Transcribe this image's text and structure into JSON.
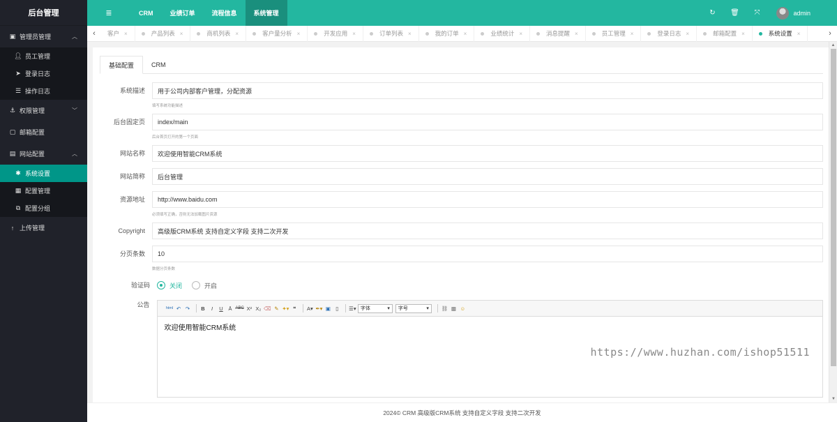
{
  "app": {
    "logo": "后台管理"
  },
  "sidebar": {
    "groups": [
      {
        "label": "管理员管理",
        "icon": "id-card-icon",
        "caret": "⌃"
      },
      {
        "label": "权限管理",
        "icon": "anchor-icon",
        "caret": "⌄"
      },
      {
        "label": "邮箱配置",
        "icon": "mail-icon"
      },
      {
        "label": "网站配置",
        "icon": "settings-icon",
        "caret": "⌃"
      },
      {
        "label": "上传管理",
        "icon": "upload-icon"
      }
    ],
    "admin_items": [
      {
        "label": "员工管理",
        "icon": "user-icon"
      },
      {
        "label": "登录日志",
        "icon": "send-icon"
      },
      {
        "label": "操作日志",
        "icon": "list-icon"
      }
    ],
    "site_items": [
      {
        "label": "系统设置",
        "icon": "gear-icon",
        "active": true
      },
      {
        "label": "配置管理",
        "icon": "grid-icon"
      },
      {
        "label": "配置分组",
        "icon": "group-icon"
      }
    ]
  },
  "topbar": {
    "menu_icon": "≣",
    "nav": [
      {
        "label": "CRM"
      },
      {
        "label": "业绩订单"
      },
      {
        "label": "流程信息"
      },
      {
        "label": "系统管理",
        "active": true
      }
    ],
    "icons": [
      "refresh-icon",
      "trash-icon",
      "fullscreen-icon"
    ],
    "user": "admin"
  },
  "tabs": [
    {
      "label": "客户"
    },
    {
      "label": "产品列表"
    },
    {
      "label": "商机列表"
    },
    {
      "label": "客户量分析"
    },
    {
      "label": "开发应用"
    },
    {
      "label": "订单列表"
    },
    {
      "label": "我的订单"
    },
    {
      "label": "业绩统计"
    },
    {
      "label": "消息提醒"
    },
    {
      "label": "员工管理"
    },
    {
      "label": "登录日志"
    },
    {
      "label": "邮箱配置"
    },
    {
      "label": "系统设置",
      "active": true
    }
  ],
  "content_tabs": [
    "基础配置",
    "CRM"
  ],
  "form": {
    "desc": {
      "label": "系统描述",
      "value": "用于公司内部客户管理，分配资源",
      "hint": "填写系统功能描述"
    },
    "home": {
      "label": "后台固定页",
      "value": "index/main",
      "hint": "后台首页打开的第一个页面"
    },
    "site_name": {
      "label": "网站名称",
      "value": "欢迎使用智能CRM系统"
    },
    "short_name": {
      "label": "网站简称",
      "value": "后台管理"
    },
    "resource": {
      "label": "资源地址",
      "value": "http://www.baidu.com",
      "hint": "必须填写正确，否则无法加载图片资源"
    },
    "copyright": {
      "label": "Copyright",
      "value": "高级版CRM系统 支持自定义字段 支持二次开发"
    },
    "page_size": {
      "label": "分页条数",
      "value": "10",
      "hint": "数据分页条数"
    },
    "captcha": {
      "label": "验证码",
      "off": "关闭",
      "on": "开启",
      "selected": "关闭"
    },
    "notice": {
      "label": "公告",
      "content": "欢迎使用智能CRM系统",
      "font_label": "字体",
      "size_label": "字号"
    }
  },
  "watermark": "https://www.huzhan.com/ishop51511",
  "footer": "2024© CRM 高级版CRM系统 支持自定义字段 支持二次开发",
  "colors": {
    "accent": "#23b7a0",
    "sidebar_bg": "#20222a",
    "active_item": "#009688"
  }
}
